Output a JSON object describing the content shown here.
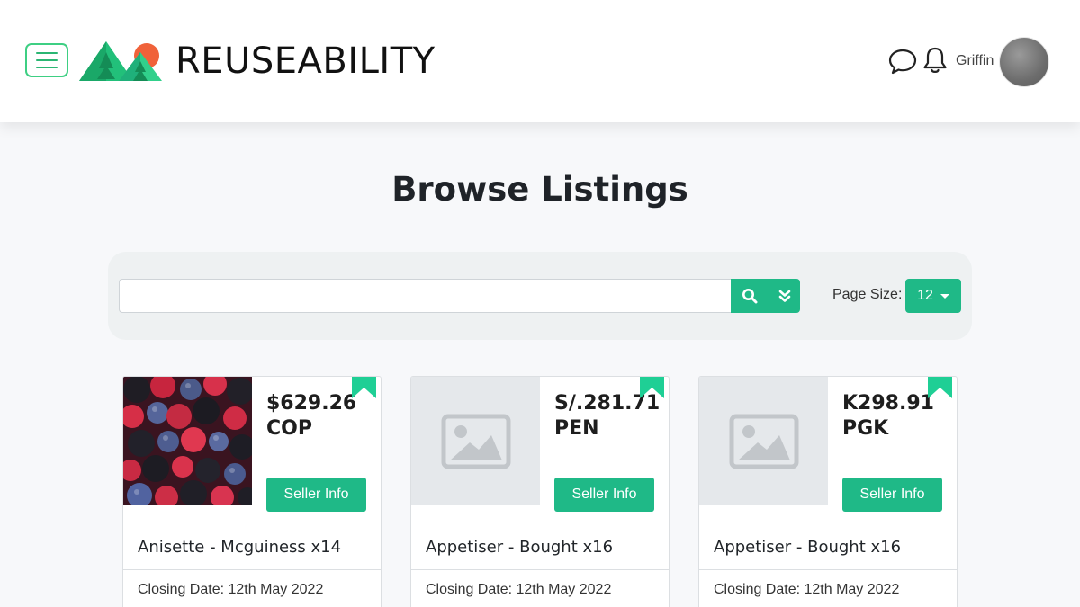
{
  "header": {
    "brand": "REUSEABILITY",
    "username": "Griffin",
    "icons": {
      "menu": "hamburger-menu-icon",
      "chat": "chat-bubble-icon",
      "bell": "bell-icon"
    },
    "accent_color": "#3ecf83"
  },
  "page": {
    "title": "Browse Listings"
  },
  "search": {
    "value": "",
    "placeholder": "",
    "search_icon": "magnifier-icon",
    "expand_icon": "double-chevron-down-icon",
    "page_size_label": "Page Size:",
    "page_size_value": "12",
    "button_color": "#1fb987"
  },
  "listings": [
    {
      "price": "$629.26 COP",
      "seller_button": "Seller Info",
      "name": "Anisette - Mcguiness x14",
      "closing": "Closing Date: 12th May 2022",
      "image": "berries-photo"
    },
    {
      "price": "S/.281.71 PEN",
      "seller_button": "Seller Info",
      "name": "Appetiser - Bought x16",
      "closing": "Closing Date: 12th May 2022",
      "image": "placeholder-image-icon"
    },
    {
      "price": "K298.91 PGK",
      "seller_button": "Seller Info",
      "name": "Appetiser - Bought x16",
      "closing": "Closing Date: 12th May 2022",
      "image": "placeholder-image-icon"
    }
  ]
}
